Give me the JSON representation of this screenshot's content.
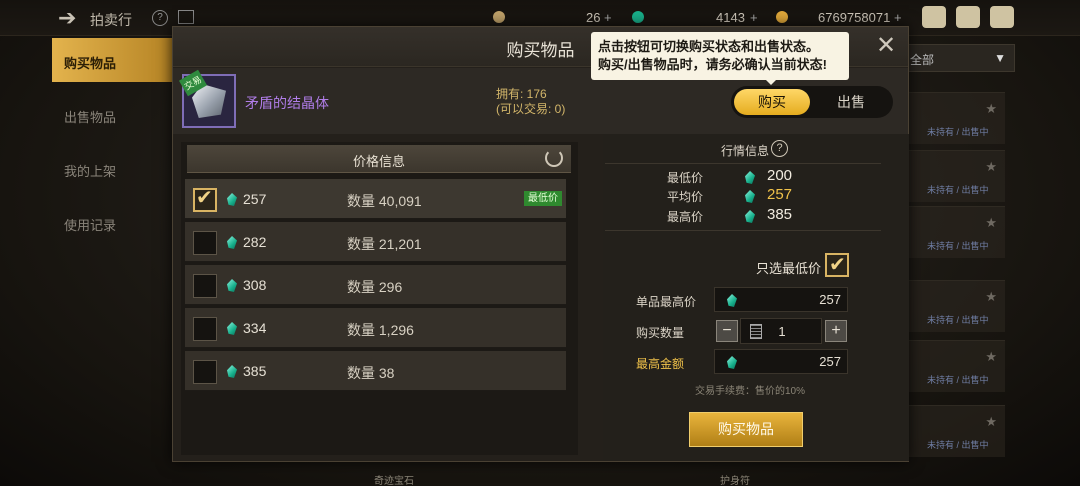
{
  "topbar": {
    "title": "拍卖行",
    "currencies": [
      {
        "name": "moon-coin-icon",
        "value": "26"
      },
      {
        "name": "green-gem-icon",
        "value": "4143"
      },
      {
        "name": "gold-coin-icon",
        "value": "6769758071"
      }
    ]
  },
  "sidebar": {
    "items": [
      {
        "label": "购买物品"
      },
      {
        "label": "出售物品"
      },
      {
        "label": "我的上架"
      },
      {
        "label": "使用记录"
      }
    ]
  },
  "background": {
    "dropdown_label": "全部",
    "rows": [
      "未持有 / 出售中",
      "未持有 / 出售中",
      "未持有 / 出售中",
      "未持有 / 出售中",
      "未持有 / 出售中",
      "未持有 / 出售中"
    ],
    "bottom_left": "奇迹宝石",
    "bottom_right": "护身符"
  },
  "dialog": {
    "title": "购买物品",
    "tooltip_line1": "点击按钮可切换购买状态和出售状态。",
    "tooltip_line2": "购买/出售物品时，请务必确认当前状态!",
    "item": {
      "name": "矛盾的结晶体",
      "trade_badge": "交易",
      "owned": "拥有: 176",
      "tradable": "(可以交易: 0)"
    },
    "toggle": {
      "buy": "购买",
      "sell": "出售"
    },
    "price_table": {
      "header": "价格信息",
      "lowest_badge": "最低价",
      "rows": [
        {
          "price": "257",
          "qty_label": "数量",
          "qty": "40,091",
          "checked": true
        },
        {
          "price": "282",
          "qty_label": "数量",
          "qty": "21,201",
          "checked": false
        },
        {
          "price": "308",
          "qty_label": "数量",
          "qty": "296",
          "checked": false
        },
        {
          "price": "334",
          "qty_label": "数量",
          "qty": "1,296",
          "checked": false
        },
        {
          "price": "385",
          "qty_label": "数量",
          "qty": "38",
          "checked": false
        }
      ]
    },
    "market": {
      "title": "行情信息",
      "help": "?",
      "lowest_label": "最低价",
      "lowest_value": "200",
      "avg_label": "平均价",
      "avg_value": "257",
      "highest_label": "最高价",
      "highest_value": "385",
      "value_colors": {
        "lowest": "#f2ece0",
        "avg": "#f0c24a",
        "highest": "#f2ece0"
      }
    },
    "form": {
      "only_lowest_label": "只选最低价",
      "unit_max_label": "单品最高价",
      "unit_max_value": "257",
      "qty_label": "购买数量",
      "qty_value": "1",
      "total_label": "最高金额",
      "total_value": "257",
      "fee_text": "交易手续费：售价的10%",
      "buy_button": "购买物品"
    }
  }
}
